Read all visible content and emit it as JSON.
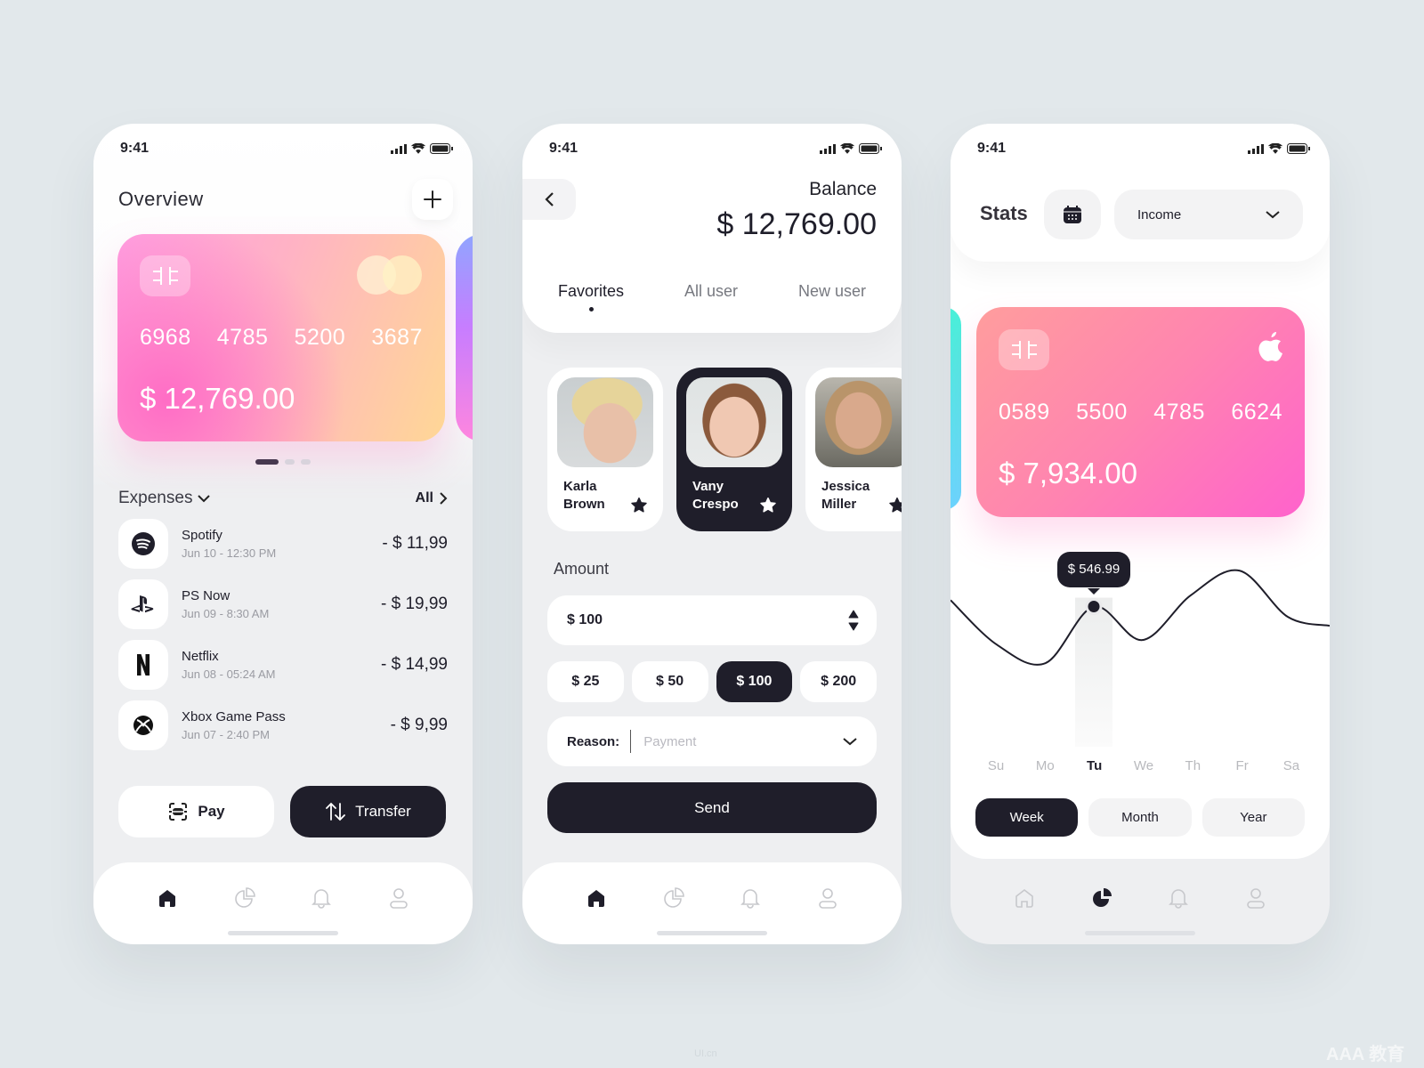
{
  "status_bar": {
    "time": "9:41"
  },
  "overview": {
    "title": "Overview",
    "card": {
      "number_groups": [
        "6968",
        "4785",
        "5200",
        "3687"
      ],
      "balance": "$ 12,769.00"
    },
    "carousel": {
      "pages": 3,
      "active": 1
    },
    "expenses_label": "Expenses",
    "all_label": "All",
    "transactions": [
      {
        "name": "Spotify",
        "date": "Jun 10 - 12:30 PM",
        "amount": "- $ 11,99",
        "icon": "spotify-icon"
      },
      {
        "name": "PS Now",
        "date": "Jun 09 - 8:30 AM",
        "amount": "- $ 19,99",
        "icon": "playstation-icon"
      },
      {
        "name": "Netflix",
        "date": "Jun 08 - 05:24 AM",
        "amount": "- $ 14,99",
        "icon": "netflix-icon"
      },
      {
        "name": "Xbox Game Pass",
        "date": "Jun 07 - 2:40 PM",
        "amount": "- $ 9,99",
        "icon": "xbox-icon"
      }
    ],
    "pay_label": "Pay",
    "transfer_label": "Transfer"
  },
  "transfer": {
    "balance_label": "Balance",
    "balance_value": "$ 12,769.00",
    "tabs": [
      {
        "label": "Favorites",
        "active": true
      },
      {
        "label": "All user",
        "active": false
      },
      {
        "label": "New user",
        "active": false
      }
    ],
    "favorites": [
      {
        "first": "Karla",
        "last": "Brown",
        "selected": false
      },
      {
        "first": "Vany",
        "last": "Crespo",
        "selected": true
      },
      {
        "first": "Jessica",
        "last": "Miller",
        "selected": false
      }
    ],
    "amount_label": "Amount",
    "amount_value": "$ 100",
    "quick_amounts": [
      {
        "label": "$ 25",
        "active": false
      },
      {
        "label": "$ 50",
        "active": false
      },
      {
        "label": "$ 100",
        "active": true
      },
      {
        "label": "$ 200",
        "active": false
      }
    ],
    "reason_label": "Reason:",
    "reason_placeholder": "Payment",
    "send_label": "Send"
  },
  "stats": {
    "title": "Stats",
    "dropdown_value": "Income",
    "card": {
      "number_groups": [
        "0589",
        "5500",
        "4785",
        "6624"
      ],
      "balance": "$ 7,934.00"
    },
    "tooltip": "$ 546.99",
    "days": [
      {
        "label": "Su",
        "active": false
      },
      {
        "label": "Mo",
        "active": false
      },
      {
        "label": "Tu",
        "active": true
      },
      {
        "label": "We",
        "active": false
      },
      {
        "label": "Th",
        "active": false
      },
      {
        "label": "Fr",
        "active": false
      },
      {
        "label": "Sa",
        "active": false
      }
    ],
    "periods": [
      {
        "label": "Week",
        "active": true
      },
      {
        "label": "Month",
        "active": false
      },
      {
        "label": "Year",
        "active": false
      }
    ]
  },
  "chart_data": {
    "type": "line",
    "title": "",
    "categories": [
      "Su",
      "Mo",
      "Tu",
      "We",
      "Th",
      "Fr",
      "Sa"
    ],
    "series": [
      {
        "name": "Income",
        "values": [
          300,
          180,
          546.99,
          330,
          620,
          780,
          480
        ]
      }
    ],
    "highlight": {
      "category": "Tu",
      "value": 546.99
    },
    "xlabel": "",
    "ylabel": "",
    "grid": false
  },
  "nav": [
    "Home",
    "Stats",
    "Notifications",
    "Profile"
  ],
  "watermarks": {
    "left": "UI.cn",
    "right": "AAA 教育"
  },
  "colors": {
    "dark": "#1f1e2a",
    "card_pink": "#ff6fcf",
    "card_peach": "#ffd796"
  }
}
